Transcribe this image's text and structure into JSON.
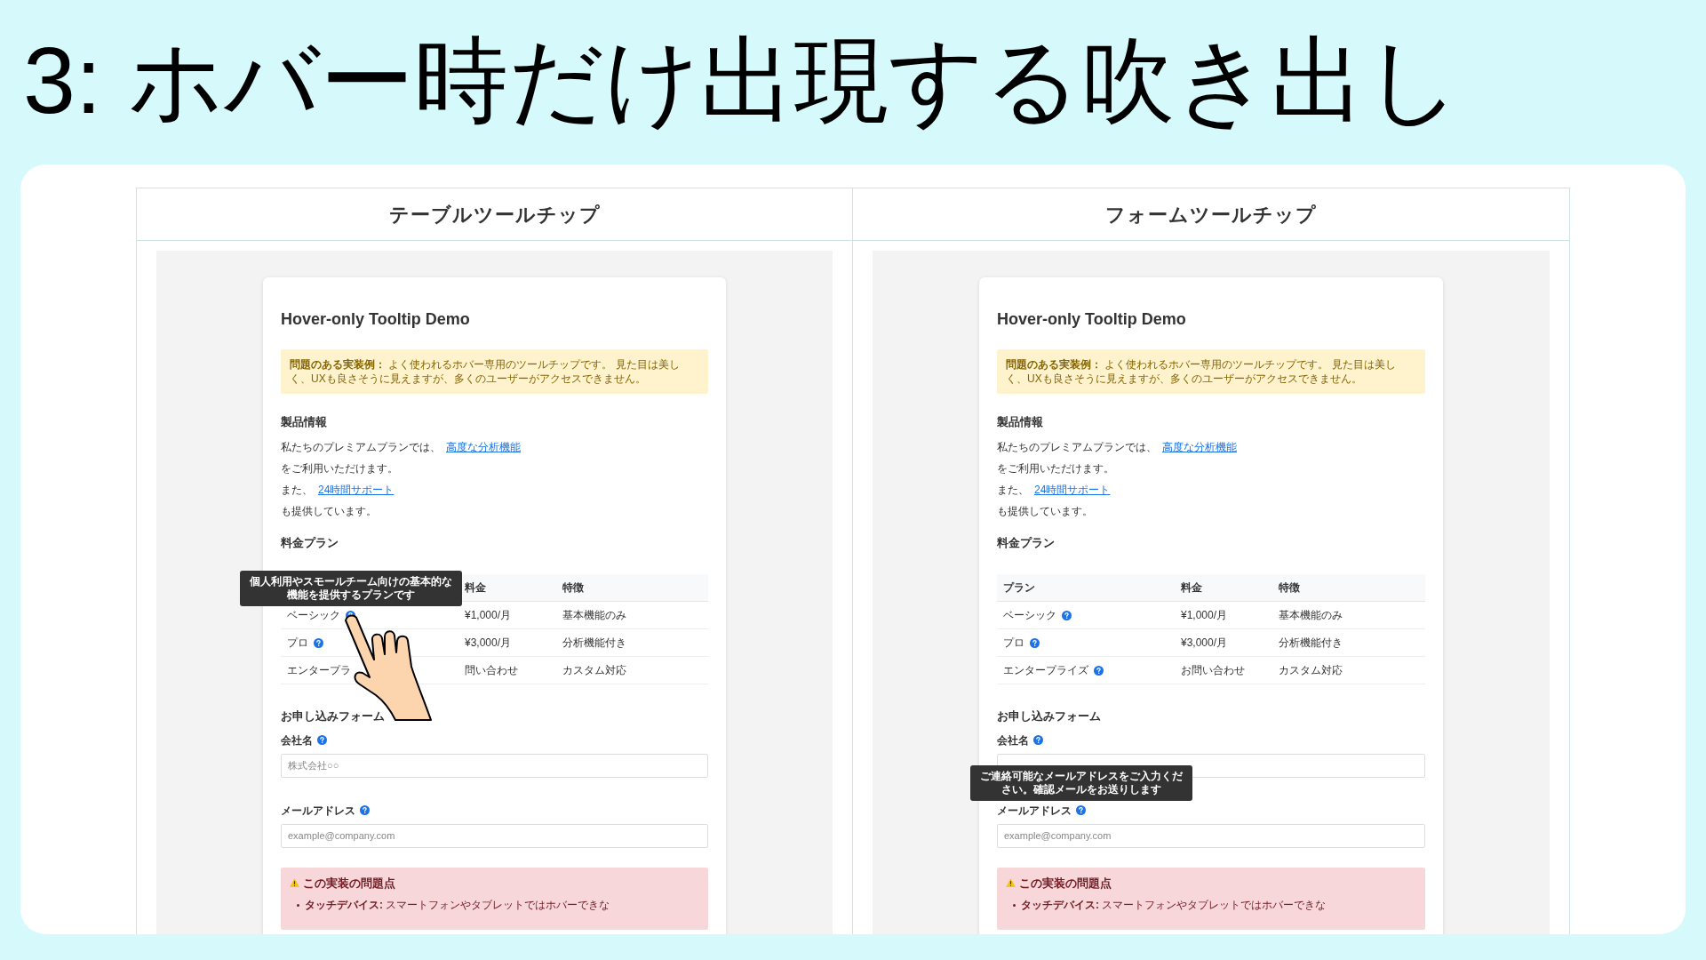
{
  "slide_title": "3: ホバー時だけ出現する吹き出し",
  "panels": [
    {
      "header": "テーブルツールチップ",
      "page": {
        "title": "Hover-only Tooltip Demo",
        "notice": "**問題のある実装例：** よく使われるホバー専用のツールチップです。 見た目は美しく、UXも良さそうに見えますが、多くのユーザーがアクセスできません。",
        "info_heading": "製品情報",
        "lines": [
          {
            "text": "私たちのプレミアムプランでは、",
            "link": "高度な分析機能"
          },
          {
            "text": "をご利用いただけます。"
          },
          {
            "text": "また、",
            "link": "24時間サポート"
          },
          {
            "text": "も提供しています。"
          }
        ],
        "table_heading": "料金プラン",
        "header": {
          "column_2": "料金",
          "column_3": "特徴"
        },
        "rows": [
          {
            "plan": "ベーシック",
            "help_icon": true,
            "price": "¥1,000/月",
            "feature": "基本機能のみ",
            "tooltip": "個人利用やスモールチーム向けの基本的な機能を提供するプランです",
            "pointing": true
          },
          {
            "plan": "プロ",
            "help_icon": true,
            "price": "¥3,000/月",
            "feature": "分析機能付き",
            "pointing": false
          },
          {
            "plan": "エンタープラ",
            "help_icon": false,
            "price": "問い合わせ",
            "feature": "カスタム対応",
            "pointing": false
          }
        ],
        "form_heading": "お申し込みフォーム",
        "fields": [
          {
            "label": "会社名",
            "placeholder": "株式会社○○"
          },
          {
            "label": "メールアドレス",
            "placeholder": "example@company.com"
          }
        ],
        "problems_heading": "この実装の問題点",
        "problems": [
          "**タッチデバイス:** スマートフォンやタブレットではホバーできな"
        ]
      }
    },
    {
      "header": "フォームツールチップ",
      "page": {
        "title": "Hover-only Tooltip Demo",
        "notice": "**問題のある実装例：** よく使われるホバー専用のツールチップです。 見た目は美しく、UXも良さそうに見えますが、多くのユーザーがアクセスできません。",
        "info_heading": "製品情報",
        "lines": [
          {
            "text": "私たちのプレミアムプランでは、",
            "link": "高度な分析機能"
          },
          {
            "text": "をご利用いただけます。"
          },
          {
            "text": "また、",
            "link": "24時間サポート"
          },
          {
            "text": "も提供しています。"
          }
        ],
        "table_heading": "料金プラン",
        "header": {
          "column_1": "プラン",
          "column_2": "料金",
          "column_3": "特徴"
        },
        "rows": [
          {
            "plan": "ベーシック",
            "help_icon": true,
            "price": "¥1,000/月",
            "feature": "基本機能のみ",
            "pointing": false
          },
          {
            "plan": "プロ",
            "help_icon": true,
            "price": "¥3,000/月",
            "feature": "分析機能付き",
            "pointing": false
          },
          {
            "plan": "エンタープライズ",
            "help_icon": true,
            "price": "お問い合わせ",
            "feature": "カスタム対応",
            "pointing": false
          }
        ],
        "form_heading": "お申し込みフォーム",
        "fields": [
          {
            "label": "会社名"
          },
          {
            "label": "メールアドレス",
            "placeholder": "example@company.com",
            "tooltip": "ご連絡可能なメールアドレスをご入力ください。確認メールをお送りします"
          }
        ],
        "problems_heading": "この実装の問題点",
        "problems": [
          "**タッチデバイス:** スマートフォンやタブレットではホバーできな"
        ]
      }
    }
  ]
}
